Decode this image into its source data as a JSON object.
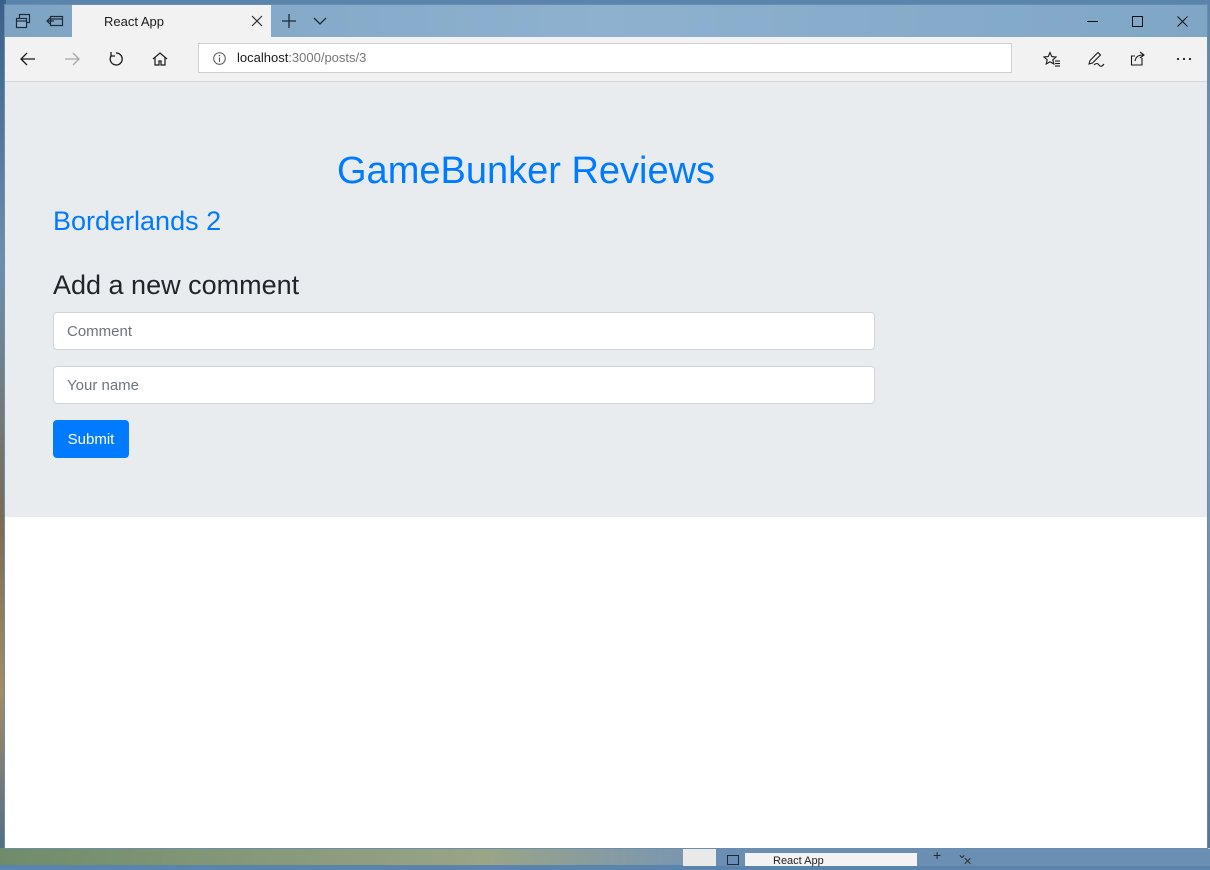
{
  "browser": {
    "tab": {
      "title": "React App"
    },
    "address_bar": {
      "host": "localhost",
      "path": ":3000/posts/3"
    }
  },
  "page": {
    "site_title": "GameBunker Reviews",
    "post_title": "Borderlands 2",
    "comment_form": {
      "heading": "Add a new comment",
      "comment_placeholder": "Comment",
      "comment_value": "",
      "name_placeholder": "Your name",
      "name_value": "",
      "submit_label": "Submit"
    }
  },
  "background_window": {
    "tab_title": "React App"
  },
  "colors": {
    "accent": "#007bff",
    "jumbotron_bg": "#e9ecef",
    "heading_text": "#212529",
    "titlebar": "#8db1cf"
  },
  "icons": [
    "tab-actions-icon",
    "set-aside-tabs-icon",
    "close-icon",
    "plus-icon",
    "chevron-down-icon",
    "minimize-icon",
    "maximize-icon",
    "back-arrow-icon",
    "forward-arrow-icon",
    "refresh-icon",
    "home-icon",
    "info-icon",
    "favorites-icon",
    "pen-icon",
    "share-icon",
    "more-icon"
  ]
}
